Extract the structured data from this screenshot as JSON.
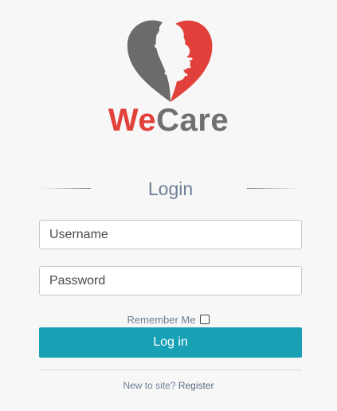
{
  "brand": {
    "name_part_1": "We",
    "name_part_2": "Care",
    "logo_icon": "heart-hand-icon",
    "colors": {
      "red": "#e2403a",
      "gray": "#707070"
    }
  },
  "login": {
    "title": "Login",
    "username_placeholder": "Username",
    "password_placeholder": "Password",
    "remember_label": "Remember Me",
    "remember_checked": false,
    "submit_label": "Log in",
    "accent_color": "#18a1b5"
  },
  "footer": {
    "prompt": "New to site?",
    "register_label": "Register"
  }
}
